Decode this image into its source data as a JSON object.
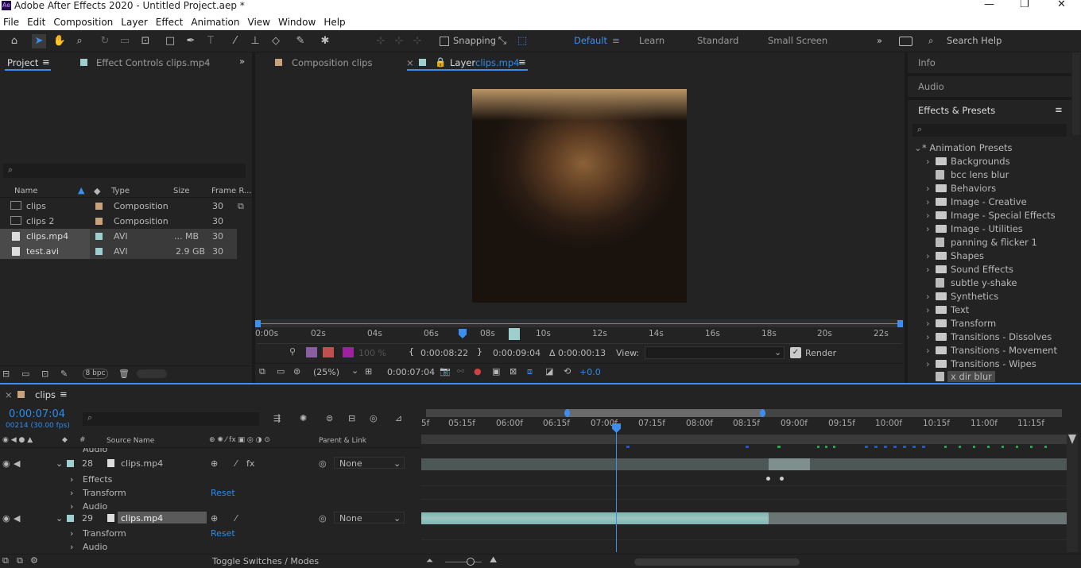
{
  "app": {
    "title": "Adobe After Effects 2020 - Untitled Project.aep *",
    "icon_text": "Ae"
  },
  "window_controls": [
    "—",
    "❐",
    "✕"
  ],
  "menu": [
    "File",
    "Edit",
    "Composition",
    "Layer",
    "Effect",
    "Animation",
    "View",
    "Window",
    "Help"
  ],
  "toolbar": {
    "snapping": "Snapping",
    "workspaces": [
      "Default",
      "Learn",
      "Standard",
      "Small Screen"
    ],
    "search": "Search Help"
  },
  "project": {
    "tab": "Project",
    "effect_controls_tab": "Effect Controls clips.mp4",
    "columns": [
      "Name",
      "Type",
      "Size",
      "Frame R..."
    ],
    "items": [
      {
        "name": "clips",
        "type": "Composition",
        "size": "",
        "fr": "30",
        "color": "#c8a27a"
      },
      {
        "name": "clips 2",
        "type": "Composition",
        "size": "",
        "fr": "30",
        "color": "#c8a27a"
      },
      {
        "name": "clips.mp4",
        "type": "AVI",
        "size": "... MB",
        "fr": "30",
        "color": "#9ecfcf"
      },
      {
        "name": "test.avi",
        "type": "AVI",
        "size": "2.9 GB",
        "fr": "30",
        "color": "#9ecfcf"
      }
    ],
    "bpc": "8 bpc"
  },
  "viewer": {
    "comp_tab": "Composition clips",
    "layer_tab": "Layer",
    "layer_name": "clips.mp4",
    "ruler": [
      "0:00s",
      "02s",
      "04s",
      "06s",
      "08s",
      "10s",
      "12s",
      "14s",
      "16s",
      "18s",
      "20s",
      "22s"
    ],
    "in_time": "0:00:08:22",
    "out_time": "0:00:09:04",
    "duration": "Δ 0:00:00:13",
    "view_label": "View:",
    "render_label": "Render",
    "opacity": "100 %",
    "zoom": "(25%)",
    "current": "0:00:07:04",
    "exposure": "+0.0"
  },
  "right": {
    "info": "Info",
    "audio": "Audio",
    "effects_presets": "Effects & Presets",
    "root": "* Animation Presets",
    "items": [
      {
        "label": "Backgrounds",
        "folder": true
      },
      {
        "label": "bcc lens blur",
        "folder": false
      },
      {
        "label": "Behaviors",
        "folder": true
      },
      {
        "label": "Image - Creative",
        "folder": true
      },
      {
        "label": "Image - Special Effects",
        "folder": true
      },
      {
        "label": "Image - Utilities",
        "folder": true
      },
      {
        "label": "panning & flicker 1",
        "folder": false
      },
      {
        "label": "Shapes",
        "folder": true
      },
      {
        "label": "Sound Effects",
        "folder": true
      },
      {
        "label": "subtle y-shake",
        "folder": false
      },
      {
        "label": "Synthetics",
        "folder": true
      },
      {
        "label": "Text",
        "folder": true
      },
      {
        "label": "Transform",
        "folder": true
      },
      {
        "label": "Transitions - Dissolves",
        "folder": true
      },
      {
        "label": "Transitions - Movement",
        "folder": true
      },
      {
        "label": "Transitions - Wipes",
        "folder": true
      },
      {
        "label": "x dir blur",
        "folder": false
      }
    ]
  },
  "timeline": {
    "comp": "clips",
    "timecode": "0:00:07:04",
    "fps": "00214 (30.00 fps)",
    "col_source": "Source Name",
    "col_parent": "Parent & Link",
    "ruler": [
      "5f",
      "05:15f",
      "06:00f",
      "06:15f",
      "07:00f",
      "07:15f",
      "08:00f",
      "08:15f",
      "09:00f",
      "09:15f",
      "10:00f",
      "10:15f",
      "11:00f",
      "11:15f"
    ],
    "rows": [
      {
        "type": "sub",
        "label": "Audio"
      },
      {
        "type": "layer",
        "num": "28",
        "name": "clips.mp4",
        "parent": "None"
      },
      {
        "type": "sub",
        "label": "Effects"
      },
      {
        "type": "sub",
        "label": "Transform",
        "reset": "Reset"
      },
      {
        "type": "sub",
        "label": "Audio"
      },
      {
        "type": "layer",
        "num": "29",
        "name": "clips.mp4",
        "parent": "None"
      },
      {
        "type": "sub",
        "label": "Transform",
        "reset": "Reset"
      },
      {
        "type": "sub",
        "label": "Audio"
      }
    ],
    "toggle": "Toggle Switches / Modes"
  }
}
